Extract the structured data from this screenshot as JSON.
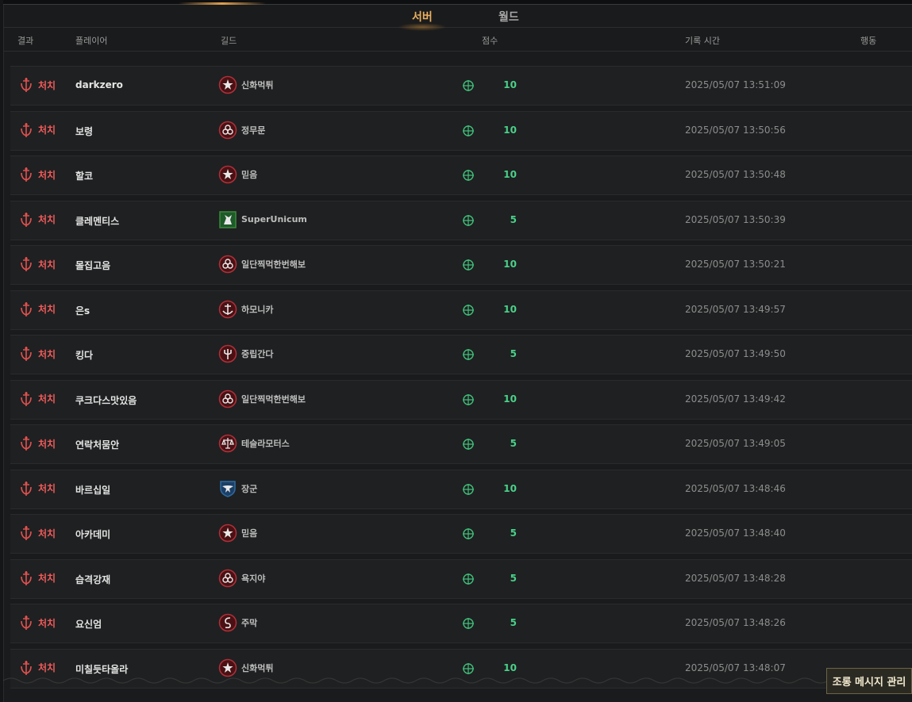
{
  "tabs": [
    {
      "label": "서버",
      "active": true
    },
    {
      "label": "월드",
      "active": false
    }
  ],
  "columns": {
    "result": "결과",
    "player": "플레이어",
    "guild": "길드",
    "score": "점수",
    "time": "기록 시간",
    "action": "행동"
  },
  "colors": {
    "kill": "#ef5b5b",
    "score": "#49d18a",
    "tab_active": "#e8b060"
  },
  "rows": [
    {
      "result": "처치",
      "player": "darkzero",
      "guild": "신화먹튀",
      "emblem": "star-emblem-icon",
      "score": "10",
      "time": "2025/05/07 13:51:09"
    },
    {
      "result": "처치",
      "player": "보령",
      "guild": "정무문",
      "emblem": "biohazard-emblem-icon",
      "score": "10",
      "time": "2025/05/07 13:50:56"
    },
    {
      "result": "처치",
      "player": "할코",
      "guild": "믿음",
      "emblem": "star-emblem-icon",
      "score": "10",
      "time": "2025/05/07 13:50:48"
    },
    {
      "result": "처치",
      "player": "클레멘티스",
      "guild": "SuperUnicum",
      "emblem": "unicorn-emblem-icon",
      "score": "5",
      "time": "2025/05/07 13:50:39"
    },
    {
      "result": "처치",
      "player": "몰집고음",
      "guild": "일단찍먹한번해보",
      "emblem": "biohazard-emblem-icon",
      "score": "10",
      "time": "2025/05/07 13:50:21"
    },
    {
      "result": "처치",
      "player": "은s",
      "guild": "하모니카",
      "emblem": "anchor-emblem-icon",
      "score": "10",
      "time": "2025/05/07 13:49:57"
    },
    {
      "result": "처치",
      "player": "킹다",
      "guild": "중립간다",
      "emblem": "trident-emblem-icon",
      "score": "5",
      "time": "2025/05/07 13:49:50"
    },
    {
      "result": "처치",
      "player": "쿠크다스맛있음",
      "guild": "일단찍먹한번해보",
      "emblem": "biohazard-emblem-icon",
      "score": "10",
      "time": "2025/05/07 13:49:42"
    },
    {
      "result": "처치",
      "player": "연락처뭄안",
      "guild": "테슬라모터스",
      "emblem": "scales-emblem-icon",
      "score": "5",
      "time": "2025/05/07 13:49:05"
    },
    {
      "result": "처치",
      "player": "바르십일",
      "guild": "장군",
      "emblem": "eagle-emblem-icon",
      "score": "10",
      "time": "2025/05/07 13:48:46"
    },
    {
      "result": "처치",
      "player": "아카데미",
      "guild": "믿음",
      "emblem": "star-emblem-icon",
      "score": "5",
      "time": "2025/05/07 13:48:40"
    },
    {
      "result": "처치",
      "player": "습격강재",
      "guild": "욕지야",
      "emblem": "biohazard-emblem-icon",
      "score": "5",
      "time": "2025/05/07 13:48:28"
    },
    {
      "result": "처치",
      "player": "요신엄",
      "guild": "주막",
      "emblem": "serpent-emblem-icon",
      "score": "5",
      "time": "2025/05/07 13:48:26"
    },
    {
      "result": "처치",
      "player": "미칠듯타올라",
      "guild": "신화먹튀",
      "emblem": "star-emblem-icon",
      "score": "10",
      "time": "2025/05/07 13:48:07"
    }
  ],
  "taunt_button": "조롱 메시지 관리"
}
